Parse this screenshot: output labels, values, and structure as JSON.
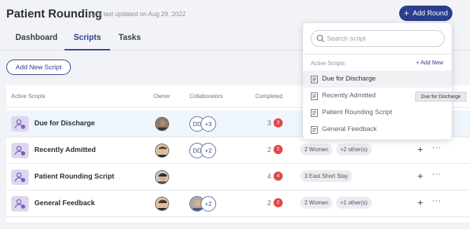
{
  "header": {
    "title": "Patient Rounding",
    "updated": "Data last updated on Aug 29, 2022",
    "add_round_label": "Add Round"
  },
  "tabs": [
    {
      "label": "Dashboard",
      "active": false
    },
    {
      "label": "Scripts",
      "active": true
    },
    {
      "label": "Tasks",
      "active": false
    }
  ],
  "toolbar": {
    "new_script_label": "Add New Script"
  },
  "table": {
    "columns": [
      "Active Scripts",
      "Owner",
      "Collaborators",
      "Completed"
    ],
    "rows": [
      {
        "name": "Due for Discharge",
        "collab_initials": "DD",
        "collab_more": "+3",
        "completed": "3",
        "badge": "3",
        "chips": []
      },
      {
        "name": "Recently Admitted",
        "collab_initials": "DD",
        "collab_more": "+2",
        "completed": "2",
        "badge": "2",
        "chips": [
          "2 Women",
          "+2 other(s)"
        ]
      },
      {
        "name": "Patient Rounding Script",
        "collab_initials": "",
        "collab_more": "",
        "completed": "4",
        "badge": "4",
        "chips": [
          "3 East Short Stay"
        ]
      },
      {
        "name": "General Feedback",
        "collab_initials": "",
        "collab_more": "+2",
        "completed": "2",
        "badge": "2",
        "chips": [
          "2 Women",
          "+1 other(s)"
        ]
      }
    ]
  },
  "dropdown": {
    "search_placeholder": "Search script",
    "section_label": "Active Scripts",
    "add_new_label": "+ Add New",
    "items": [
      "Due for Discharge",
      "Recently Admitted",
      "Patient Rounding Script",
      "General Feedback"
    ]
  },
  "tooltip": "Due for Discharge",
  "colors": {
    "primary": "#2a3d8f",
    "badge": "#e04848",
    "row_highlight": "#eef5fb",
    "icon_bg": "#ddd6ef"
  }
}
